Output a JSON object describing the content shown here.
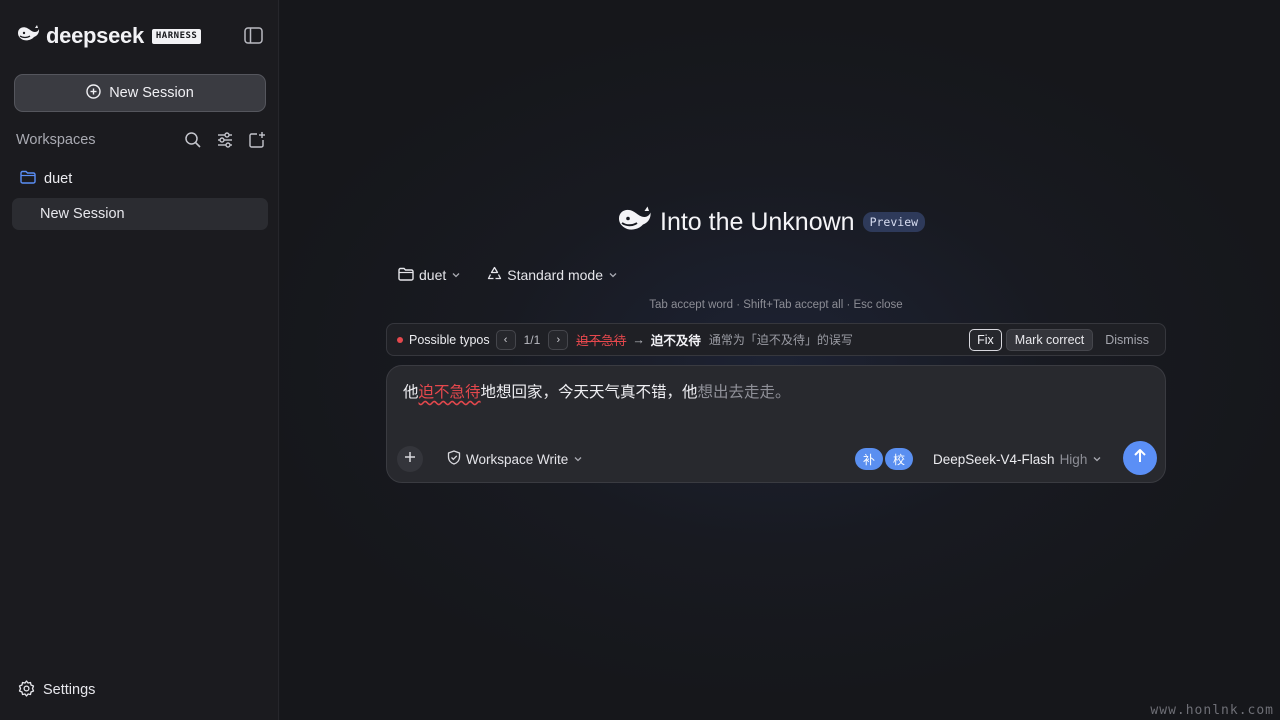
{
  "sidebar": {
    "brand": "deepseek",
    "brand_badge": "HARNESS",
    "new_session_label": "New Session",
    "workspaces_label": "Workspaces",
    "folder_name": "duet",
    "session_item": "New Session",
    "settings_label": "Settings"
  },
  "main": {
    "title": "Into the Unknown",
    "badge": "Preview",
    "folder_selector": "duet",
    "mode_selector": "Standard mode",
    "hint": "Tab accept word · Shift+Tab accept all · Esc close"
  },
  "typo_bar": {
    "label": "Possible typos",
    "prev": "‹",
    "next": "›",
    "counter": "1/1",
    "wrong": "迫不急待",
    "arrow": "→",
    "correct": "迫不及待",
    "note": "通常为「迫不及待」的误写",
    "fix_label": "Fix",
    "mark_label": "Mark correct",
    "dismiss_label": "Dismiss"
  },
  "composer": {
    "text_before": "他",
    "text_typo": "迫不急待",
    "text_after": "地想回家，今天天气真不错，他",
    "ghost_text": "想出去走走。",
    "permission_label": "Workspace Write",
    "pill_1": "补",
    "pill_2": "校",
    "model_name": "DeepSeek-V4-Flash",
    "model_level": "High"
  },
  "watermark": "www.honlnk.com",
  "colors": {
    "accent": "#5b8ff6",
    "typo_red": "#e5484d",
    "preview_badge_bg": "#2e3a5a"
  }
}
